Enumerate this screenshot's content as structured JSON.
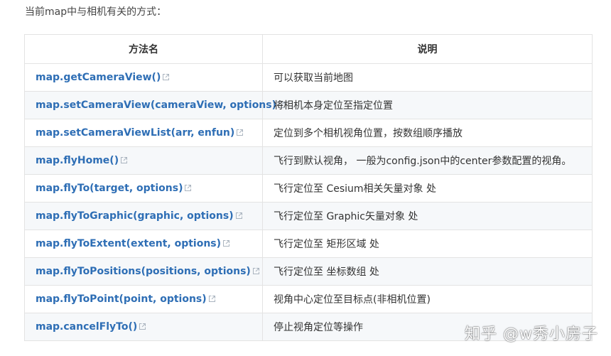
{
  "intro": "当前map中与相机有关的方式：",
  "table": {
    "headers": [
      "方法名",
      "说明"
    ],
    "rows": [
      {
        "method": "map.getCameraView()",
        "description": "可以获取当前地图"
      },
      {
        "method": "map.setCameraView(cameraView, options)",
        "description": "将相机本身定位至指定位置"
      },
      {
        "method": "map.setCameraViewList(arr, enfun)",
        "description": "定位到多个相机视角位置，按数组顺序播放"
      },
      {
        "method": "map.flyHome()",
        "description": "飞行到默认视角，  一般为config.json中的center参数配置的视角。"
      },
      {
        "method": "map.flyTo(target, options)",
        "description": "飞行定位至 Cesium相关矢量对象 处"
      },
      {
        "method": "map.flyToGraphic(graphic, options)",
        "description": "飞行定位至 Graphic矢量对象 处"
      },
      {
        "method": "map.flyToExtent(extent, options)",
        "description": "飞行定位至 矩形区域 处"
      },
      {
        "method": "map.flyToPositions(positions, options)",
        "description": "飞行定位至 坐标数组 处"
      },
      {
        "method": "map.flyToPoint(point, options)",
        "description": "视角中心定位至目标点(非相机位置)"
      },
      {
        "method": "map.cancelFlyTo()",
        "description": "停止视角定位等操作"
      }
    ]
  },
  "watermark": "知乎 @w秀小房子",
  "colors": {
    "link": "#2e6eb5",
    "stripe": "#f6f8fa",
    "border": "#e3e3e3"
  }
}
